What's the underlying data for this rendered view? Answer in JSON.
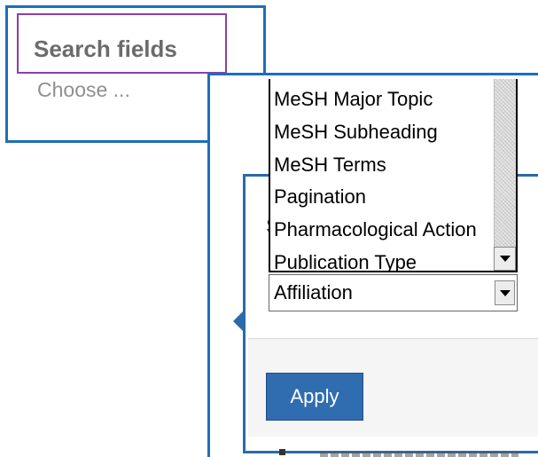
{
  "search_fields": {
    "title": "Search fields",
    "choose_label": "Choose ..."
  },
  "dropdown": {
    "options": [
      "MeSH Major Topic",
      "MeSH Subheading",
      "MeSH Terms",
      "Pagination",
      "Pharmacological Action",
      "Publication Type"
    ],
    "selected_value": "Affiliation"
  },
  "panel": {
    "partial_text": "S",
    "apply_label": "Apply"
  },
  "colors": {
    "callout_border": "#1d6fb8",
    "title_highlight_border": "#8a40a8",
    "apply_button": "#2f6db0"
  },
  "icons": {
    "scroll_down": "chevron-down-icon",
    "select_arrow": "chevron-down-icon"
  }
}
